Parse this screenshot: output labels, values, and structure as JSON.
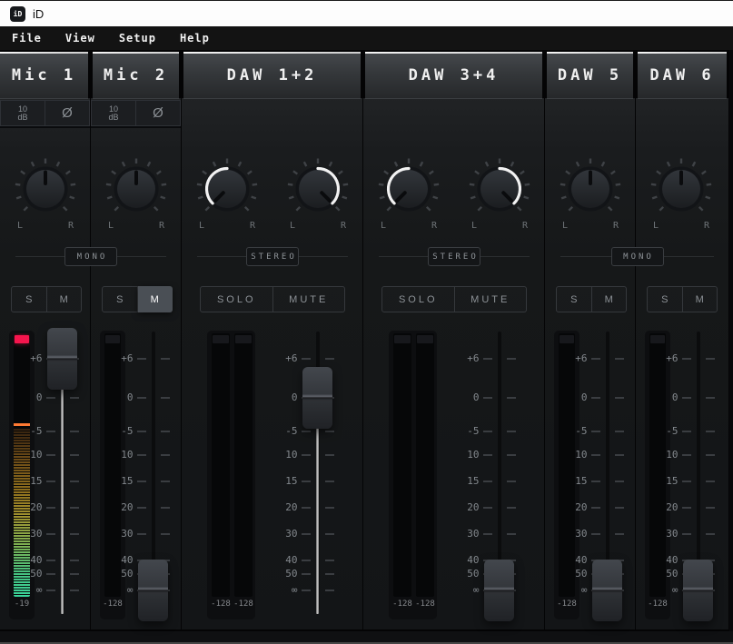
{
  "window": {
    "logo_text": "iD",
    "title": "iD"
  },
  "menu": {
    "items": [
      "File",
      "View",
      "Setup",
      "Help"
    ]
  },
  "fader_scale": [
    "+6",
    "0",
    "-5",
    "10",
    "15",
    "20",
    "30",
    "40",
    "50",
    "∞"
  ],
  "pan_labels": [
    "L",
    "R"
  ],
  "colors": {
    "clip_lit": "#f5154d",
    "peak_hold": "#ff7a33",
    "active_button_bg": "#4a4f55",
    "header_text": "#efefef"
  },
  "groups": [
    {
      "link_label": "MONO",
      "channels": [
        {
          "name": "Mic 1",
          "type": "mono",
          "pad_label": "10\ndB",
          "phase_label": "Ø",
          "solo_label": "S",
          "mute_label": "M",
          "solo_active": false,
          "mute_active": false,
          "pans": [
            "center"
          ],
          "fader_value": "+6",
          "meters": [
            {
              "value": "-19",
              "clipped": true,
              "fill_percent": 64,
              "peak_percent": 34
            }
          ]
        },
        {
          "name": "Mic 2",
          "type": "mono",
          "pad_label": "10\ndB",
          "phase_label": "Ø",
          "solo_label": "S",
          "mute_label": "M",
          "solo_active": false,
          "mute_active": true,
          "pans": [
            "center"
          ],
          "fader_value": "∞",
          "meters": [
            {
              "value": "-128",
              "clipped": false,
              "fill_percent": 0
            }
          ]
        }
      ]
    },
    {
      "link_label": "STEREO",
      "channels": [
        {
          "name": "DAW 1+2",
          "type": "stereo",
          "solo_label": "SOLO",
          "mute_label": "MUTE",
          "solo_active": false,
          "mute_active": false,
          "pans": [
            "left",
            "right"
          ],
          "fader_value": "0",
          "meters": [
            {
              "value": "-128",
              "clipped": false,
              "fill_percent": 0
            },
            {
              "value": "-128",
              "clipped": false,
              "fill_percent": 0
            }
          ]
        }
      ]
    },
    {
      "link_label": "STEREO",
      "channels": [
        {
          "name": "DAW 3+4",
          "type": "stereo",
          "solo_label": "SOLO",
          "mute_label": "MUTE",
          "solo_active": false,
          "mute_active": false,
          "pans": [
            "left",
            "right"
          ],
          "fader_value": "∞",
          "meters": [
            {
              "value": "-128",
              "clipped": false,
              "fill_percent": 0
            },
            {
              "value": "-128",
              "clipped": false,
              "fill_percent": 0
            }
          ]
        }
      ]
    },
    {
      "link_label": "MONO",
      "channels": [
        {
          "name": "DAW 5",
          "type": "mono",
          "solo_label": "S",
          "mute_label": "M",
          "solo_active": false,
          "mute_active": false,
          "pans": [
            "center"
          ],
          "fader_value": "∞",
          "meters": [
            {
              "value": "-128",
              "clipped": false,
              "fill_percent": 0
            }
          ]
        },
        {
          "name": "DAW 6",
          "type": "mono",
          "solo_label": "S",
          "mute_label": "M",
          "solo_active": false,
          "mute_active": false,
          "pans": [
            "center"
          ],
          "fader_value": "∞",
          "meters": [
            {
              "value": "-128",
              "clipped": false,
              "fill_percent": 0
            }
          ]
        }
      ]
    }
  ]
}
